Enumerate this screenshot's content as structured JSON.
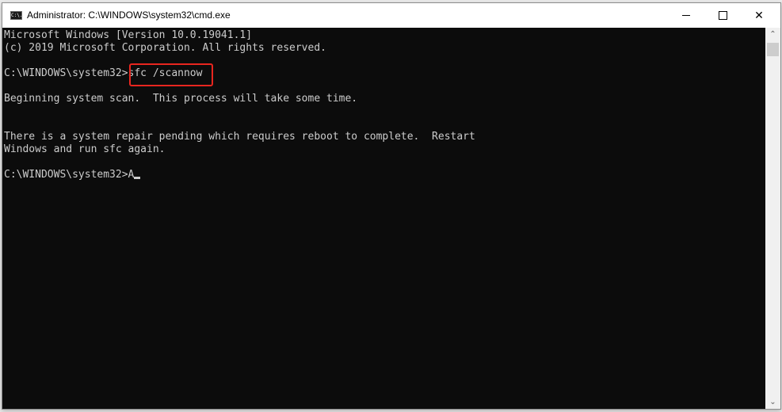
{
  "window": {
    "title": "Administrator: C:\\WINDOWS\\system32\\cmd.exe",
    "icon": "cmd-icon",
    "icon_text": "C:\\.",
    "controls": {
      "minimize": "minimize-icon",
      "maximize": "maximize-icon",
      "close": "close-icon",
      "close_glyph": "✕"
    }
  },
  "console": {
    "lines": [
      "Microsoft Windows [Version 10.0.19041.1]",
      "(c) 2019 Microsoft Corporation. All rights reserved.",
      "",
      "C:\\WINDOWS\\system32>sfc /scannow",
      "",
      "Beginning system scan.  This process will take some time.",
      "",
      "",
      "There is a system repair pending which requires reboot to complete.  Restart",
      "Windows and run sfc again.",
      "",
      "C:\\WINDOWS\\system32>A"
    ],
    "highlighted_command": "sfc /scannow",
    "highlight_color": "#e8261f",
    "text_color": "#cccccc",
    "background_color": "#0c0c0c"
  },
  "scrollbar": {
    "up_glyph": "⌃",
    "down_glyph": "⌄"
  }
}
